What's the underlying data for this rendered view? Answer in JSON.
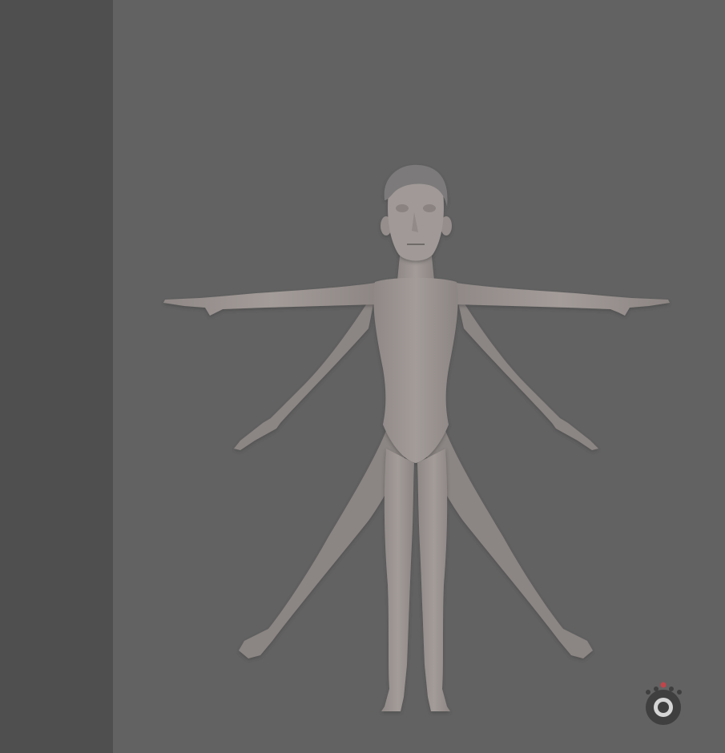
{
  "viewport": {
    "background": "#626262",
    "model": {
      "pose_count": 2,
      "skin_color": "#9a9391",
      "hair_color": "#7b7a7a"
    }
  },
  "side_panel": {
    "background": "#4f4f4f"
  },
  "logo": {
    "icon": "aperture-camera-icon",
    "accent_color": "#c0454a"
  }
}
